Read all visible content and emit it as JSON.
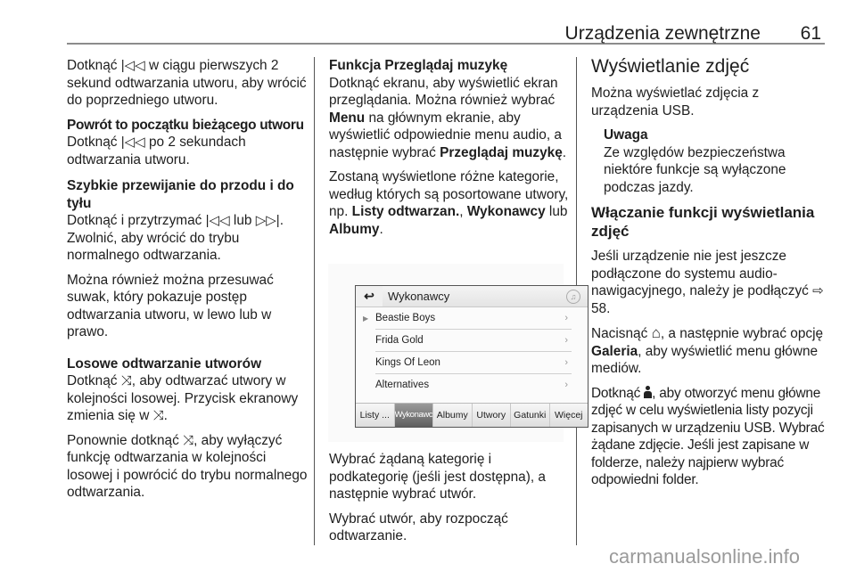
{
  "header": {
    "title": "Urządzenia zewnętrzne",
    "page_number": "61"
  },
  "col1": {
    "p1": [
      "Dotknąć ",
      "|◁◁",
      " w ciągu pierwszych 2 sekund odtwarzania utworu, aby wrócić do poprzedniego utworu."
    ],
    "h_restart": "Powrót to początku bieżącego utworu",
    "p2": [
      "Dotknąć ",
      "|◁◁",
      " po 2 sekundach odtwarzania utworu."
    ],
    "h_ffwd": "Szybkie przewijanie do przodu i do tyłu",
    "p3": [
      "Dotknąć i przytrzymać ",
      "|◁◁",
      " lub ",
      "▷▷|",
      ". Zwolnić, aby wrócić do trybu normalnego odtwarzania."
    ],
    "p4": "Można również można przesuwać suwak, który pokazuje postęp odtwarzania utworu, w lewo lub w prawo.",
    "h_shuffle": "Losowe odtwarzanie utworów",
    "p5": [
      "Dotknąć ",
      "⤨",
      ", aby odtwarzać utwory w kolejności losowej. Przycisk ekranowy zmienia się w ",
      "⤨",
      "."
    ],
    "p6": [
      "Ponownie dotknąć ",
      "⤨",
      ", aby wyłączyć funkcję odtwarzania w kolejności losowej i powrócić do trybu normalnego odtwarzania."
    ]
  },
  "col2": {
    "h_browse": "Funkcja Przeglądaj muzykę",
    "p1": [
      "Dotknąć ekranu, aby wyświetlić ekran przeglądania. Można również wybrać ",
      "Menu",
      " na głównym ekranie, aby wyświetlić odpowiednie menu audio, a następnie wybrać ",
      "Przeglądaj muzykę",
      "."
    ],
    "p2": [
      "Zostaną wyświetlone różne kategorie, według których są posortowane utwory, np. ",
      "Listy odtwarzan.",
      ", ",
      "Wykonawcy",
      " lub ",
      "Albumy",
      "."
    ],
    "screen": {
      "back_icon": "↩",
      "title": "Wykonawcy",
      "music_icon": "♫",
      "rows": [
        {
          "label": "Beastie Boys",
          "playing": true
        },
        {
          "label": "Frida Gold",
          "playing": false
        },
        {
          "label": "Kings Of Leon",
          "playing": false
        },
        {
          "label": "Alternatives",
          "playing": false
        }
      ],
      "chevron": "›",
      "tabs": [
        "Listy ...",
        "Wykonawcy",
        "Albumy",
        "Utwory",
        "Gatunki",
        "Więcej"
      ],
      "active_tab": "Wykonawcy"
    },
    "p3": "Wybrać żądaną kategorię i podkategorię (jeśli jest dostępna), a następnie wybrać utwór.",
    "p4": "Wybrać utwór, aby rozpocząć odtwarzanie."
  },
  "col3": {
    "h_photos": "Wyświetlanie zdjęć",
    "p1": "Można wyświetlać zdjęcia z urządzenia USB.",
    "note_title": "Uwaga",
    "note_text": "Ze względów bezpieczeństwa niektóre funkcje są wyłączone podczas jazdy.",
    "h_enable": "Włączanie funkcji wyświetlania zdjęć",
    "p2": [
      "Jeśli urządzenie nie jest jeszcze podłączone do systemu audio-nawigacyjnego, należy je podłączyć ",
      "⇨",
      " 58."
    ],
    "p3": [
      "Nacisnąć ",
      "⌂",
      ", a następnie wybrać opcję ",
      "Galeria",
      ", aby wyświetlić menu główne mediów."
    ],
    "p4": [
      "Dotknąć ",
      "👤",
      ", aby otworzyć menu główne zdjęć w celu wyświetlenia listy pozycji zapisanych w urządzeniu USB. Wybrać żądane zdjęcie. Jeśli jest zapisane w folderze, należy najpierw wybrać odpowiedni folder."
    ]
  },
  "watermark": "carmanualsonline.info"
}
